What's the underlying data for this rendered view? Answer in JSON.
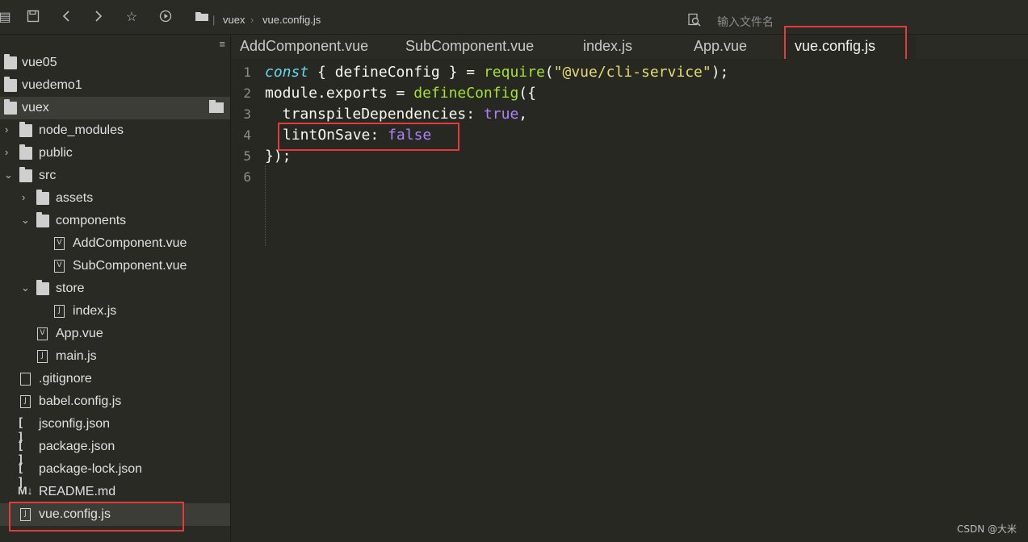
{
  "toolbar": {
    "breadcrumb": [
      "vuex",
      "vue.config.js"
    ],
    "search_placeholder": "输入文件名"
  },
  "sidebar": {
    "menu_icon": "≡",
    "items": [
      {
        "label": "vue05",
        "type": "folder",
        "expanded": false
      },
      {
        "label": "vuedemo1",
        "type": "folder",
        "expanded": false
      },
      {
        "label": "vuex",
        "type": "folder",
        "expanded": true
      },
      {
        "label": "node_modules",
        "type": "folder",
        "expanded": false
      },
      {
        "label": "public",
        "type": "folder",
        "expanded": false
      },
      {
        "label": "src",
        "type": "folder",
        "expanded": true
      },
      {
        "label": "assets",
        "type": "folder",
        "expanded": false
      },
      {
        "label": "components",
        "type": "folder",
        "expanded": true
      },
      {
        "label": "AddComponent.vue",
        "type": "vue"
      },
      {
        "label": "SubComponent.vue",
        "type": "vue"
      },
      {
        "label": "store",
        "type": "folder",
        "expanded": true
      },
      {
        "label": "index.js",
        "type": "js"
      },
      {
        "label": "App.vue",
        "type": "vue"
      },
      {
        "label": "main.js",
        "type": "js"
      },
      {
        "label": ".gitignore",
        "type": "file"
      },
      {
        "label": "babel.config.js",
        "type": "js"
      },
      {
        "label": "jsconfig.json",
        "type": "json"
      },
      {
        "label": "package.json",
        "type": "json"
      },
      {
        "label": "package-lock.json",
        "type": "json"
      },
      {
        "label": "README.md",
        "type": "md"
      },
      {
        "label": "vue.config.js",
        "type": "js",
        "selected": true
      }
    ]
  },
  "tabs": [
    {
      "label": "AddComponent.vue"
    },
    {
      "label": "SubComponent.vue"
    },
    {
      "label": "index.js"
    },
    {
      "label": "App.vue"
    },
    {
      "label": "vue.config.js",
      "active": true
    }
  ],
  "editor": {
    "line_numbers": [
      "1",
      "2",
      "3",
      "4",
      "5",
      "6"
    ],
    "tokens": {
      "l1_const": "const",
      "l1_mid": " { defineConfig } = ",
      "l1_require": "require",
      "l1_open": "(",
      "l1_str": "\"@vue/cli-service\"",
      "l1_close": ");",
      "l2_a": "module.exports = ",
      "l2_fn": "defineConfig",
      "l2_b": "({",
      "l3_key": "  transpileDependencies",
      "l3_colon": ": ",
      "l3_val": "true",
      "l3_comma": ",",
      "l4_key": "lintOnSave",
      "l4_colon": ": ",
      "l4_val": "false",
      "l5": "});"
    }
  },
  "watermark": "CSDN @大米",
  "colors": {
    "background": "#272822",
    "highlight_box": "#e23b3b",
    "keyword": "#66d9ef",
    "function": "#a6e22e",
    "string": "#e6db74",
    "boolean": "#ae81ff"
  },
  "icons": {
    "toolbar": [
      "sidebar-toggle-icon",
      "save-icon",
      "back-icon",
      "forward-icon",
      "star-icon",
      "run-icon",
      "folder-icon",
      "search-file-icon"
    ]
  }
}
